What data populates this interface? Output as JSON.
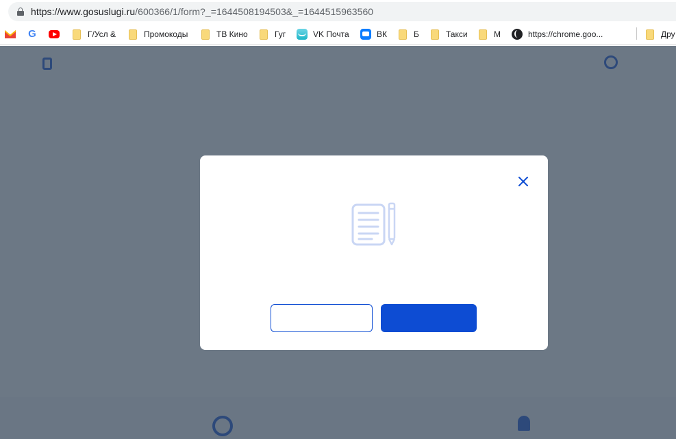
{
  "browser": {
    "url_host": "https://www.gosuslugi.ru",
    "url_path": "/600366/1/form?_=1644508194503&_=1644515963560"
  },
  "bookmarks": [
    {
      "label": "",
      "icon": "gmail-icon"
    },
    {
      "label": "",
      "icon": "google-icon"
    },
    {
      "label": "",
      "icon": "youtube-icon"
    },
    {
      "label": "Г/Усл &",
      "icon": "folder-icon"
    },
    {
      "label": "Промокоды",
      "icon": "folder-icon"
    },
    {
      "label": "ТВ Кино",
      "icon": "folder-icon"
    },
    {
      "label": "Гуг",
      "icon": "folder-icon"
    },
    {
      "label": "VK Почта",
      "icon": "vk-mail-icon"
    },
    {
      "label": "ВК",
      "icon": "vk-icon"
    },
    {
      "label": "Б",
      "icon": "folder-icon"
    },
    {
      "label": "Такси",
      "icon": "folder-icon"
    },
    {
      "label": "М",
      "icon": "folder-icon"
    },
    {
      "label": "https://chrome.goo...",
      "icon": "globe-icon"
    },
    {
      "label": "Дру",
      "icon": "folder-icon"
    }
  ],
  "modal": {
    "icon": "document-pencil-icon",
    "close_icon": "close-icon",
    "secondary_button_label": "",
    "primary_button_label": ""
  },
  "colors": {
    "accent": "#0d4cd3",
    "overlay": "#39495b",
    "illustration": "#c9d6f4"
  }
}
